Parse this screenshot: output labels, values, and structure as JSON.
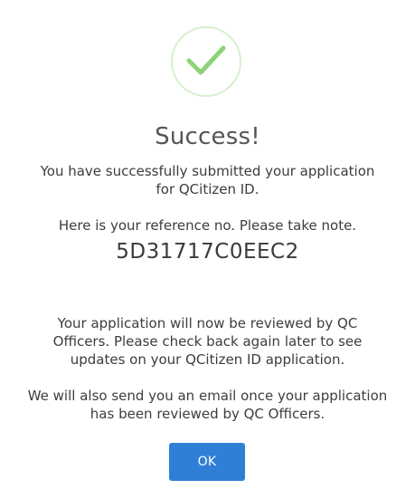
{
  "dialog": {
    "icon": "check-icon",
    "colors": {
      "check": "#8ed37a",
      "ring": "#d7f0cd",
      "button": "#2f7fd6",
      "button_text": "#ffffff"
    },
    "title": "Success!",
    "submitted_message": "You have successfully submitted your application for QCitizen ID.",
    "reference_note": "Here is your reference no. Please take note.",
    "reference_number": "5D31717C0EEC2",
    "review_message": "Your application will now be reviewed by QC Officers. Please check back again later to see updates on your QCitizen ID application.",
    "email_message": "We will also send you an email once your application has been reviewed by QC Officers.",
    "ok_label": "OK"
  }
}
